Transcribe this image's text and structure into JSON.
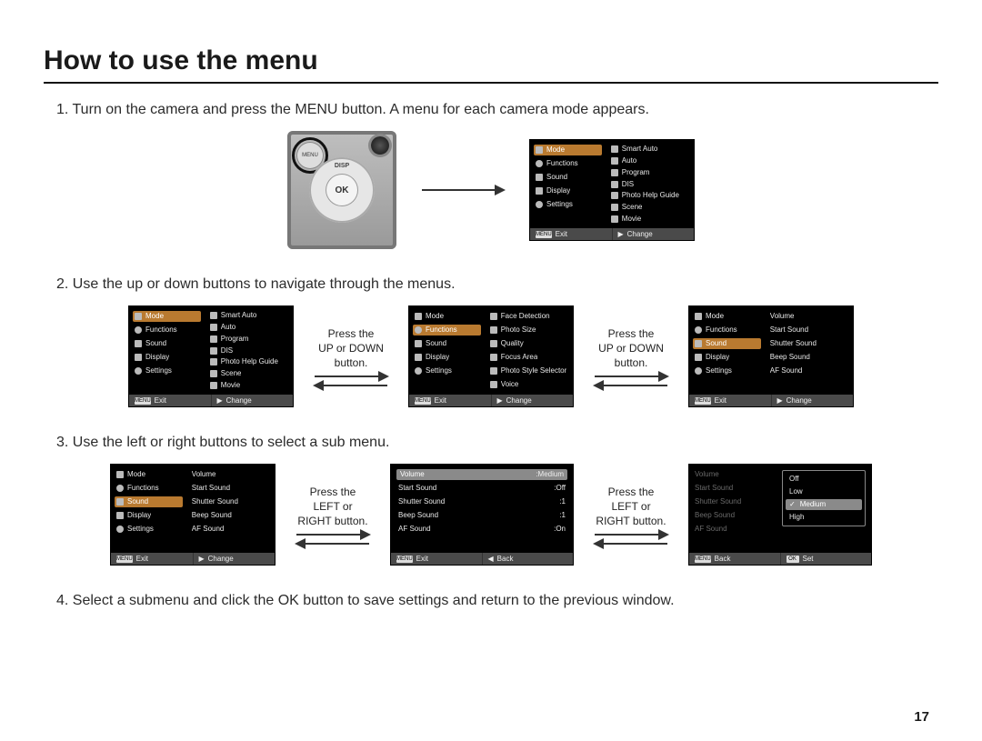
{
  "page": {
    "title": "How to use the menu",
    "number": "17",
    "steps": {
      "s1": "1. Turn on the camera and press the MENU button. A menu for each camera mode appears.",
      "s2": "2. Use the up or down buttons to navigate through the menus.",
      "s3": "3. Use the left or right buttons to select a sub menu.",
      "s4": "4. Select a submenu and click the OK button to save settings and return to the previous window."
    }
  },
  "remote": {
    "menu_label": "MENU",
    "ok_label": "OK",
    "disp_label": "DISP"
  },
  "arrows": {
    "updown": "Press the\nUP or DOWN\nbutton.",
    "leftright": "Press the\nLEFT or\nRIGHT button."
  },
  "menu_left": {
    "items": [
      "Mode",
      "Functions",
      "Sound",
      "Display",
      "Settings"
    ]
  },
  "menu_mode_right": {
    "items": [
      "Smart Auto",
      "Auto",
      "Program",
      "DIS",
      "Photo Help Guide",
      "Scene",
      "Movie"
    ]
  },
  "menu_functions_right": {
    "items": [
      "Face Detection",
      "Photo Size",
      "Quality",
      "Focus Area",
      "Photo Style Selector",
      "Voice"
    ]
  },
  "menu_sound_right": {
    "items": [
      "Volume",
      "Start Sound",
      "Shutter Sound",
      "Beep Sound",
      "AF Sound"
    ]
  },
  "sound_values": {
    "volume": ":Medium",
    "start": ":Off",
    "shutter": ":1",
    "beep": ":1",
    "af": ":On"
  },
  "volume_options": [
    "Off",
    "Low",
    "Medium",
    "High"
  ],
  "footer": {
    "menu_key": "MENU",
    "ok_key": "OK",
    "exit": "Exit",
    "change": "Change",
    "back": "Back",
    "set": "Set",
    "nav_right": "▶",
    "nav_left": "◀"
  }
}
